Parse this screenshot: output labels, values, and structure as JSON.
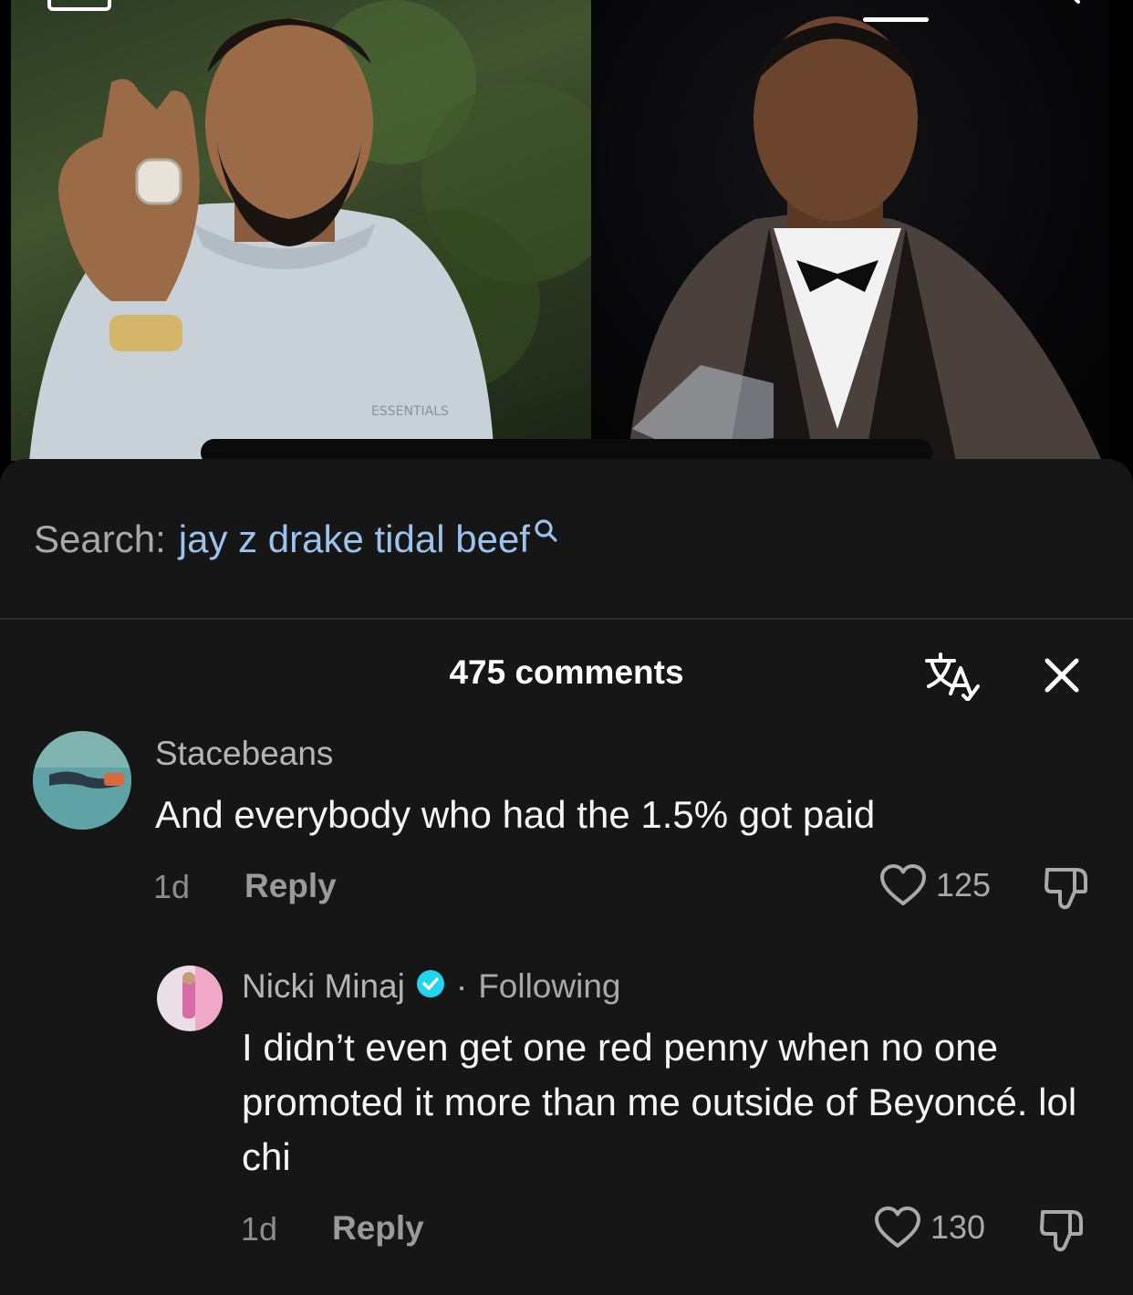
{
  "search": {
    "label": "Search:",
    "term": "jay z drake tidal beef"
  },
  "comments_header": {
    "count_label": "475 comments"
  },
  "comments": [
    {
      "username": "Stacebeans",
      "text": "And everybody who had the 1.5% got paid",
      "age": "1d",
      "reply_label": "Reply",
      "likes": "125"
    },
    {
      "username": "Nicki Minaj",
      "separator": "·",
      "follow_status": "Following",
      "text": "I didn’t even get one red penny when no one promoted it more than me outside of Beyoncé. lol chi",
      "age": "1d",
      "reply_label": "Reply",
      "likes": "130"
    }
  ],
  "colors": {
    "background": "#121212",
    "search_term": "#9cc3ee",
    "verified": "#20d5ec"
  },
  "icons": [
    "translate-icon",
    "close-icon",
    "heart-icon",
    "dislike-icon",
    "search-icon",
    "verified-icon"
  ]
}
